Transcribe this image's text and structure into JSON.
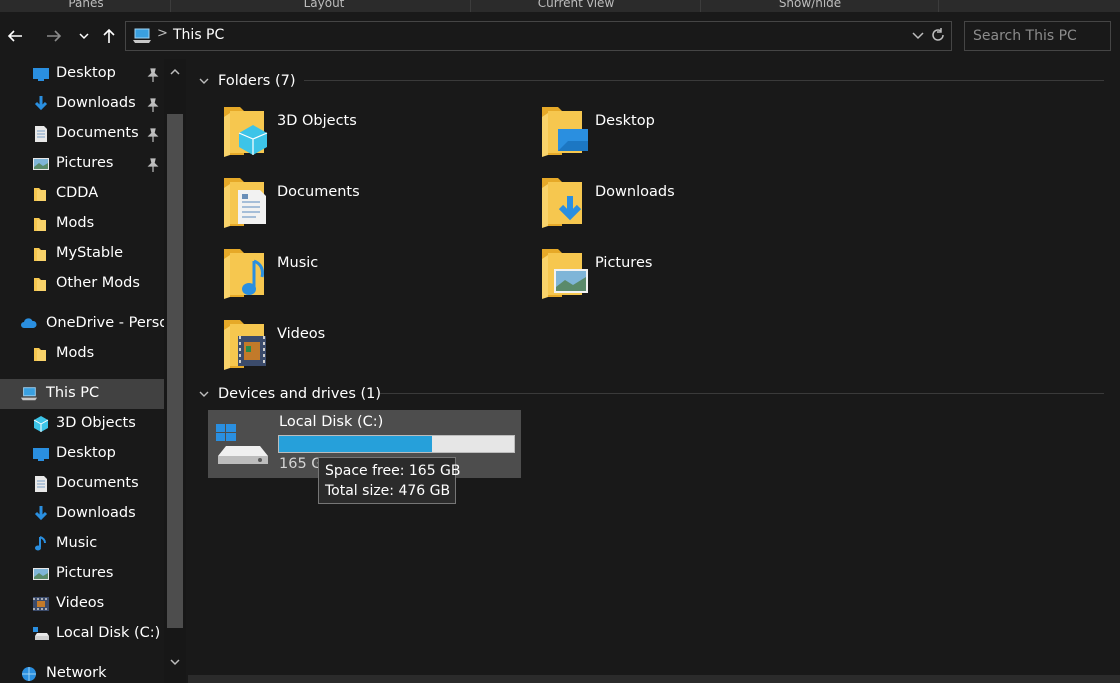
{
  "ribbon": {
    "groups": [
      "Panes",
      "Layout",
      "Current view",
      "Show/hide"
    ]
  },
  "nav": {
    "back_icon": "arrow-left-icon",
    "forward_icon": "arrow-right-icon",
    "recent_icon": "chevron-down-icon",
    "up_icon": "arrow-up-icon"
  },
  "address": {
    "crumb": "This PC",
    "separator": ">"
  },
  "search": {
    "placeholder": "Search This PC"
  },
  "sidebar": {
    "quick_access": [
      {
        "label": "Desktop",
        "icon": "desktop-icon",
        "pinned": true
      },
      {
        "label": "Downloads",
        "icon": "downloads-icon",
        "pinned": true
      },
      {
        "label": "Documents",
        "icon": "documents-icon",
        "pinned": true
      },
      {
        "label": "Pictures",
        "icon": "pictures-icon",
        "pinned": true
      },
      {
        "label": "CDDA",
        "icon": "folder-icon",
        "pinned": false
      },
      {
        "label": "Mods",
        "icon": "folder-icon",
        "pinned": false
      },
      {
        "label": "MyStable",
        "icon": "folder-icon",
        "pinned": false
      },
      {
        "label": "Other Mods",
        "icon": "folder-icon",
        "pinned": false
      }
    ],
    "onedrive": {
      "label": "OneDrive - Person",
      "icon": "onedrive-icon"
    },
    "onedrive_children": [
      {
        "label": "Mods",
        "icon": "folder-icon"
      }
    ],
    "this_pc": {
      "label": "This PC",
      "icon": "this-pc-icon"
    },
    "this_pc_children": [
      {
        "label": "3D Objects",
        "icon": "3d-objects-icon"
      },
      {
        "label": "Desktop",
        "icon": "desktop-icon"
      },
      {
        "label": "Documents",
        "icon": "documents-icon"
      },
      {
        "label": "Downloads",
        "icon": "downloads-icon"
      },
      {
        "label": "Music",
        "icon": "music-icon"
      },
      {
        "label": "Pictures",
        "icon": "pictures-icon"
      },
      {
        "label": "Videos",
        "icon": "videos-icon"
      },
      {
        "label": "Local Disk (C:)",
        "icon": "drive-icon"
      }
    ],
    "network": {
      "label": "Network",
      "icon": "network-icon"
    }
  },
  "main": {
    "folders_header": "Folders (7)",
    "folders": [
      {
        "label": "3D Objects",
        "icon": "3d-objects-folder-icon"
      },
      {
        "label": "Desktop",
        "icon": "desktop-folder-icon"
      },
      {
        "label": "Documents",
        "icon": "documents-folder-icon"
      },
      {
        "label": "Downloads",
        "icon": "downloads-folder-icon"
      },
      {
        "label": "Music",
        "icon": "music-folder-icon"
      },
      {
        "label": "Pictures",
        "icon": "pictures-folder-icon"
      },
      {
        "label": "Videos",
        "icon": "videos-folder-icon"
      }
    ],
    "devices_header": "Devices and drives (1)",
    "drive": {
      "label": "Local Disk (C:)",
      "info_visible": "165 GB",
      "used_fraction": 0.653,
      "icon": "windows-drive-icon"
    },
    "tooltip": {
      "line1": "Space free: 165 GB",
      "line2": "Total size: 476 GB"
    }
  },
  "colors": {
    "background": "#191919",
    "selection": "#414141",
    "accent_bar": "#26a0da",
    "folder_yellow": "#f6c74f"
  }
}
